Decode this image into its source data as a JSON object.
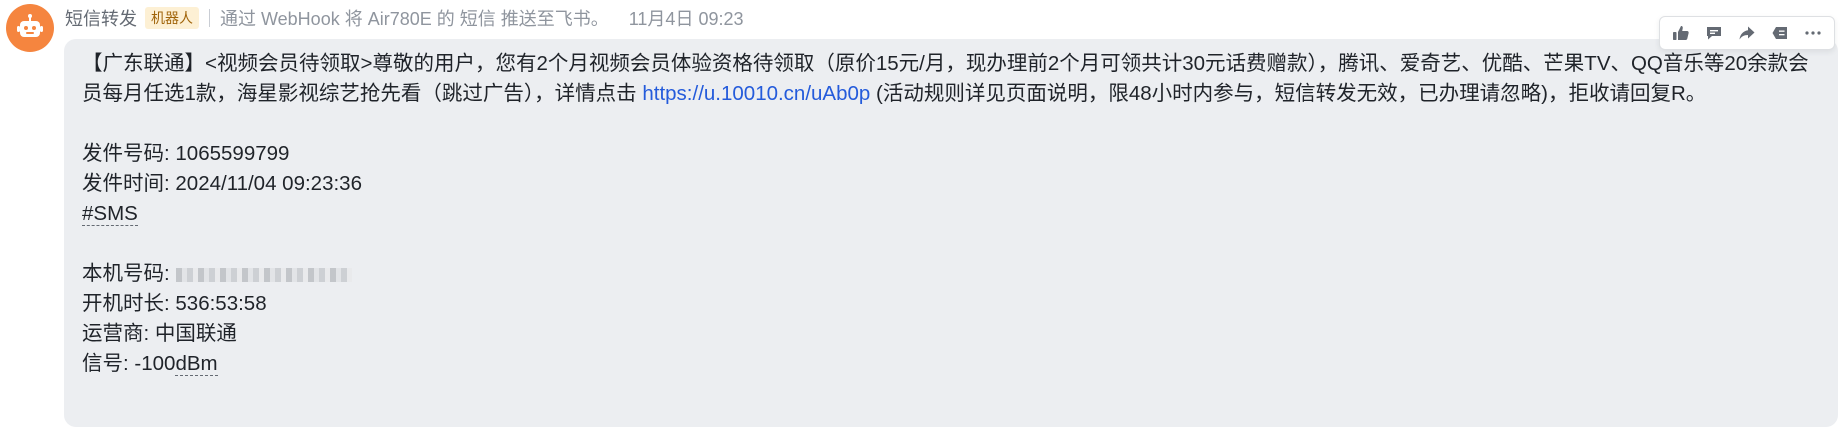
{
  "header": {
    "sender": "短信转发",
    "bot_badge": "机器人",
    "description": "通过 WebHook 将 Air780E 的 短信 推送至飞书。",
    "timestamp": "11月4日 09:23"
  },
  "message": {
    "text_before_link": "【广东联通】<视频会员待领取>尊敬的用户，您有2个月视频会员体验资格待领取（原价15元/月，现办理前2个月可领共计30元话费赠款），腾讯、爱奇艺、优酷、芒果TV、QQ音乐等20余款会员每月任选1款，海星影视综艺抢先看（跳过广告），详情点击 ",
    "link": "https://u.10010.cn/uAb0p",
    "text_after_link": " (活动规则详见页面说明，限48小时内参与，短信转发无效，已办理请忽略)，拒收请回复R。",
    "sender_label": "发件号码:",
    "sender_value": "1065599799",
    "time_label": "发件时间:",
    "time_value": "2024/11/04 09:23:36",
    "tag": "#SMS",
    "local_number_label": "本机号码:",
    "uptime_label": "开机时长:",
    "uptime_value": "536:53:58",
    "carrier_label": "运营商:",
    "carrier_value": "中国联通",
    "signal_label": "信号:",
    "signal_prefix": "-100",
    "signal_unit": "dBm"
  },
  "toolbar": {
    "actions": [
      "thumbs-up-icon",
      "reply-icon",
      "forward-icon",
      "pin-icon",
      "more-icon"
    ]
  },
  "colors": {
    "avatar": "#f5853f",
    "bubble": "#eceef1",
    "link": "#245bdb",
    "badge_bg": "#fdf0d4",
    "badge_text": "#a0640a"
  }
}
